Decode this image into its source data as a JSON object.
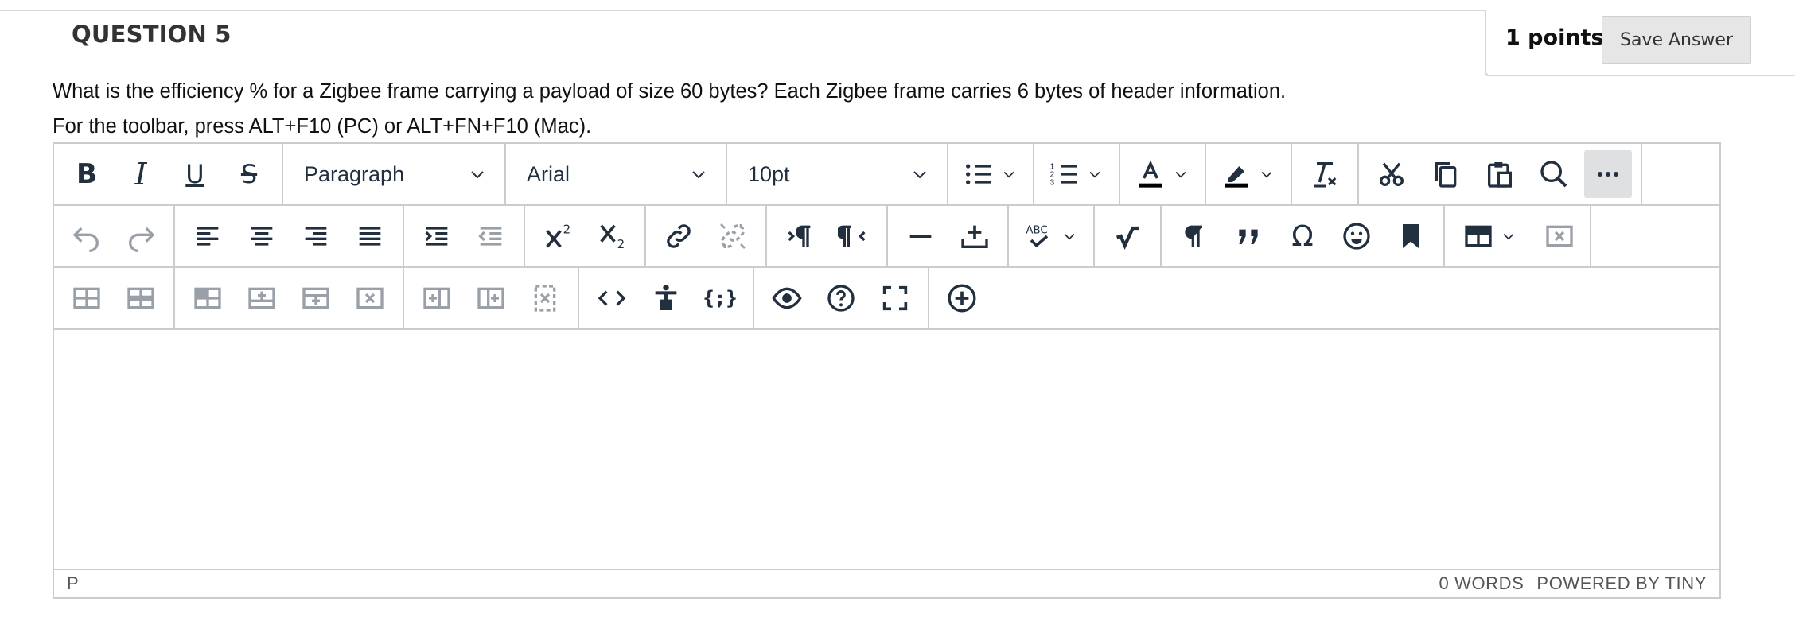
{
  "question": {
    "title": "QUESTION 5",
    "points_label": "1 points",
    "save_label": "Save Answer",
    "text": "What is the efficiency % for a Zigbee frame carrying a payload of size 60 bytes? Each Zigbee frame carries 6 bytes of header information.",
    "toolbar_hint": "For the toolbar, press ALT+F10 (PC) or ALT+FN+F10 (Mac)."
  },
  "toolbar": {
    "block_format": "Paragraph",
    "font_family": "Arial",
    "font_size": "10pt",
    "text_color_accent": "#222f3e",
    "more_active_bg": "#dee0e2"
  },
  "statusbar": {
    "path": "P",
    "word_count": "0 WORDS",
    "powered_by": "POWERED BY TINY"
  },
  "icons": {
    "row1": [
      "bold-icon",
      "italic-icon",
      "underline-icon",
      "strikethrough-icon",
      "bullet-list-icon",
      "numbered-list-icon",
      "text-color-icon",
      "highlight-icon",
      "clear-formatting-icon",
      "cut-icon",
      "copy-icon",
      "paste-icon",
      "search-icon",
      "more-icon"
    ],
    "row2": [
      "undo-icon",
      "redo-icon",
      "align-left-icon",
      "align-center-icon",
      "align-right-icon",
      "justify-icon",
      "indent-icon",
      "outdent-icon",
      "superscript-icon",
      "subscript-icon",
      "link-icon",
      "unlink-icon",
      "ltr-icon",
      "rtl-icon",
      "horizontal-rule-icon",
      "insert-icon",
      "spellcheck-icon",
      "math-icon",
      "paragraph-mark-icon",
      "quote-icon",
      "omega-icon",
      "emoji-icon",
      "bookmark-icon",
      "table-icon",
      "delete-table-icon"
    ],
    "row3": [
      "table-row-props-icon",
      "table-cell-props-icon",
      "table-header-icon",
      "insert-row-before-icon",
      "insert-row-after-icon",
      "delete-row-icon",
      "insert-col-before-icon",
      "insert-col-after-icon",
      "delete-col-icon",
      "code-icon",
      "accessibility-icon",
      "template-icon",
      "preview-icon",
      "help-icon",
      "fullscreen-icon",
      "add-icon"
    ]
  }
}
